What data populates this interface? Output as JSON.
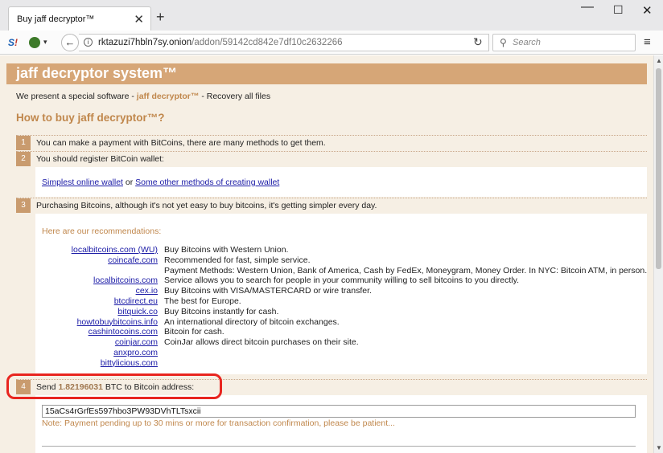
{
  "browser": {
    "tab_title": "Buy jaff decryptor™",
    "tab_close": "✕",
    "new_tab": "+",
    "window": {
      "minimize": "—",
      "maximize": "☐",
      "close": "✕"
    },
    "url_host": "rktazuzi7hbln7sy.onion",
    "url_path": "/addon/59142cd842e7df10c2632266",
    "search_placeholder": "Search",
    "back": "←",
    "reload": "↻",
    "menu": "≡"
  },
  "page": {
    "header_title": "jaff decryptor system™",
    "intro_prefix": "We present a special software - ",
    "intro_brand": "jaff decryptor™",
    "intro_suffix": " - Recovery all files",
    "how_title": "How to buy jaff decryptor™?",
    "steps": [
      {
        "num": "1",
        "text": "You can make a payment with BitCoins, there are many methods to get them."
      },
      {
        "num": "2",
        "text": "You should register BitCoin wallet:"
      },
      {
        "num": "3",
        "text": "Purchasing Bitcoins, although it's not yet easy to buy bitcoins, it's getting simpler every day."
      },
      {
        "num": "4",
        "text_prefix": "Send ",
        "amount": "1.82196031",
        "text_suffix": " BTC to Bitcoin address:"
      }
    ],
    "wallet_links": {
      "simple": "Simplest online wallet",
      "or": " or ",
      "other": "Some other methods of creating wallet"
    },
    "recommendations_heading": "Here are our recommendations:",
    "recommendations": [
      {
        "site": "localbitcoins.com (WU)",
        "desc": "Buy Bitcoins with Western Union."
      },
      {
        "site": "coincafe.com",
        "desc": "Recommended for fast, simple service."
      },
      {
        "site": "",
        "desc": "Payment Methods: Western Union, Bank of America, Cash by FedEx, Moneygram, Money Order. In NYC: Bitcoin ATM, in person."
      },
      {
        "site": "localbitcoins.com",
        "desc": "Service allows you to search for people in your community willing to sell bitcoins to you directly."
      },
      {
        "site": "cex.io",
        "desc": "Buy Bitcoins with VISA/MASTERCARD or wire transfer."
      },
      {
        "site": "btcdirect.eu",
        "desc": "The best for Europe."
      },
      {
        "site": "bitquick.co",
        "desc": "Buy Bitcoins instantly for cash."
      },
      {
        "site": "howtobuybitcoins.info",
        "desc": "An international directory of bitcoin exchanges."
      },
      {
        "site": "cashintocoins.com",
        "desc": "Bitcoin for cash."
      },
      {
        "site": "coinjar.com",
        "desc": "CoinJar allows direct bitcoin purchases on their site."
      },
      {
        "site": "anxpro.com",
        "desc": ""
      },
      {
        "site": "bittylicious.com",
        "desc": ""
      }
    ],
    "bitcoin_address": "15aCs4rGrfEs597hbo3PW93DVhTLTsxcii",
    "payment_note": "Note: Payment pending up to 30 mins or more for transaction confirmation, please be patient..."
  }
}
